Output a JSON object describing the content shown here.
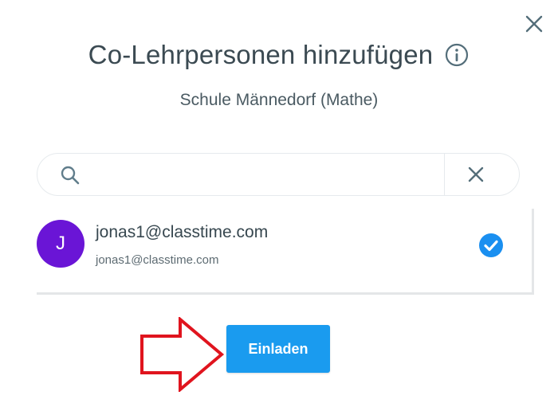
{
  "dialog": {
    "title": "Co-Lehrpersonen hinzufügen",
    "subtitle": "Schule Männedorf (Mathe)"
  },
  "search": {
    "value": "",
    "placeholder": ""
  },
  "results": [
    {
      "avatar_letter": "J",
      "name": "jonas1@classtime.com",
      "email": "jonas1@classtime.com",
      "selected": true
    }
  ],
  "actions": {
    "invite_label": "Einladen"
  },
  "colors": {
    "accent": "#1a9bef",
    "avatar": "#6a15d6",
    "annotation_arrow": "#e0141e"
  },
  "icons": [
    "close-icon",
    "info-icon",
    "search-icon",
    "clear-icon",
    "check-circle-icon",
    "arrow-annotation-icon"
  ]
}
